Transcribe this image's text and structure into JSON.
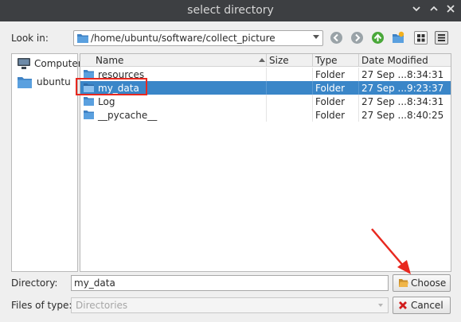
{
  "window": {
    "title": "select directory",
    "controls": [
      "chevron-down-icon",
      "chevron-up-icon",
      "close-icon"
    ]
  },
  "toolbar": {
    "look_in_label": "Look in:",
    "path": "/home/ubuntu/software/collect_picture",
    "buttons": [
      "back-icon",
      "forward-icon",
      "parent-dir-icon",
      "new-folder-icon",
      "icon-view-icon",
      "detail-view-icon"
    ]
  },
  "sidebar": {
    "items": [
      {
        "label": "Computer",
        "icon": "computer-icon"
      },
      {
        "label": "ubuntu",
        "icon": "folder-icon"
      }
    ]
  },
  "filelist": {
    "columns": [
      "Name",
      "Size",
      "Type",
      "Date Modified"
    ],
    "sort": {
      "column": "Name",
      "direction": "ascending"
    },
    "rows": [
      {
        "name": "resources",
        "size": "",
        "type": "Folder",
        "date": "27 Sep ...8:34:31",
        "selected": false
      },
      {
        "name": "my_data",
        "size": "",
        "type": "Folder",
        "date": "27 Sep ...9:23:37",
        "selected": true
      },
      {
        "name": "Log",
        "size": "",
        "type": "Folder",
        "date": "27 Sep ...8:34:31",
        "selected": false
      },
      {
        "name": "__pycache__",
        "size": "",
        "type": "Folder",
        "date": "27 Sep ...8:40:25",
        "selected": false
      }
    ]
  },
  "footer": {
    "directory_label": "Directory:",
    "directory_value": "my_data",
    "files_of_type_label": "Files of type:",
    "files_of_type_value": "Directories",
    "choose_label": "Choose",
    "cancel_label": "Cancel"
  },
  "colors": {
    "selection": "#3a86c8",
    "annotation": "#e8281f",
    "titlebar": "#3d3f42"
  }
}
